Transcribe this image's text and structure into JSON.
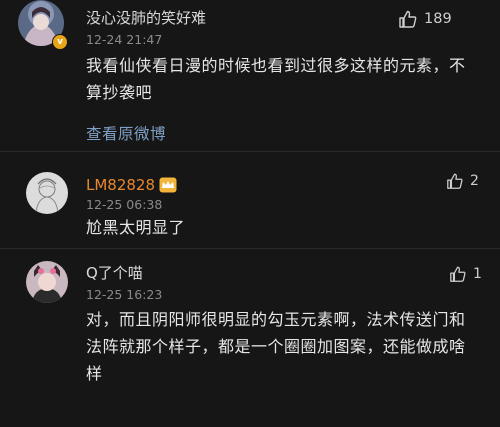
{
  "comments": [
    {
      "username": "没心没肺的笑好难",
      "timestamp": "12-24 21:47",
      "like_count": "189",
      "text": "我看仙侠看日漫的时候也看到过很多这样的元素，不算抄袭吧",
      "view_original": "查看原微博",
      "verified_badge": "v",
      "avatar_icon": "avatar-girl-icon"
    },
    {
      "username": "LM82828",
      "timestamp": "12-25 06:38",
      "like_count": "2",
      "text": "尬黑太明显了",
      "username_color": "#e8872e",
      "member_badge_icon": "crown-icon",
      "avatar_icon": "avatar-sketch-icon"
    },
    {
      "username": "Q了个喵",
      "timestamp": "12-25 16:23",
      "like_count": "1",
      "text": "对，而且阴阳师很明显的勾玉元素啊，法术传送门和法阵就那个样子，都是一个圈圈加图案，还能做成啥样",
      "avatar_icon": "avatar-cat-ears-icon"
    }
  ],
  "colors": {
    "background": "#161616",
    "link": "#7e9fc4",
    "secondary_text": "#8a8a8a",
    "primary_text": "#e6e6e6"
  }
}
